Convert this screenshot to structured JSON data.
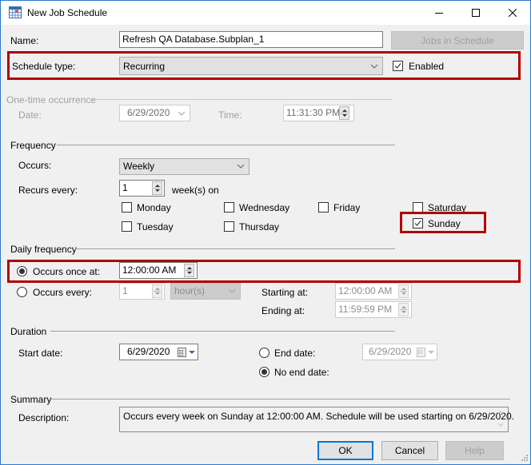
{
  "window": {
    "title": "New Job Schedule",
    "icon": "calendar-grid-icon",
    "controls": [
      "minimize-icon",
      "maximize-icon",
      "close-icon"
    ]
  },
  "colors": {
    "highlight_border": "#b20000",
    "window_border": "#2b79d0",
    "default_button_border": "#0078d7",
    "dialog_bg": "#f0f0f0"
  },
  "general": {
    "name_label": "Name:",
    "name_value": "Refresh QA Database.Subplan_1",
    "jobs_in_schedule_label": "Jobs in Schedule",
    "schedule_type_label": "Schedule type:",
    "schedule_type_value": "Recurring",
    "enabled_label": "Enabled",
    "enabled_checked": true
  },
  "one_time": {
    "group_label": "One-time occurrence",
    "date_label": "Date:",
    "date_value": "6/29/2020",
    "time_label": "Time:",
    "time_value": "11:31:30 PM"
  },
  "frequency": {
    "group_label": "Frequency",
    "occurs_label": "Occurs:",
    "occurs_value": "Weekly",
    "recurs_every_label": "Recurs every:",
    "recurs_every_value": "1",
    "recurs_unit": "week(s) on",
    "days": [
      {
        "label": "Monday",
        "checked": false
      },
      {
        "label": "Tuesday",
        "checked": false
      },
      {
        "label": "Wednesday",
        "checked": false
      },
      {
        "label": "Thursday",
        "checked": false
      },
      {
        "label": "Friday",
        "checked": false
      },
      {
        "label": "Saturday",
        "checked": false
      },
      {
        "label": "Sunday",
        "checked": true
      }
    ]
  },
  "daily_frequency": {
    "group_label": "Daily frequency",
    "occurs_once_label": "Occurs once at:",
    "occurs_once_selected": true,
    "occurs_once_value": "12:00:00 AM",
    "occurs_every_label": "Occurs every:",
    "occurs_every_selected": false,
    "occurs_every_value": "1",
    "occurs_every_unit": "hour(s)",
    "starting_at_label": "Starting at:",
    "starting_at_value": "12:00:00 AM",
    "ending_at_label": "Ending at:",
    "ending_at_value": "11:59:59 PM"
  },
  "duration": {
    "group_label": "Duration",
    "start_date_label": "Start date:",
    "start_date_value": "6/29/2020",
    "end_date_label": "End date:",
    "end_date_selected": false,
    "end_date_value": "6/29/2020",
    "no_end_date_label": "No end date:",
    "no_end_date_selected": true
  },
  "summary": {
    "group_label": "Summary",
    "description_label": "Description:",
    "description_value": "Occurs every week on Sunday at 12:00:00 AM. Schedule will be used starting on 6/29/2020."
  },
  "buttons": {
    "ok": "OK",
    "cancel": "Cancel",
    "help": "Help"
  }
}
